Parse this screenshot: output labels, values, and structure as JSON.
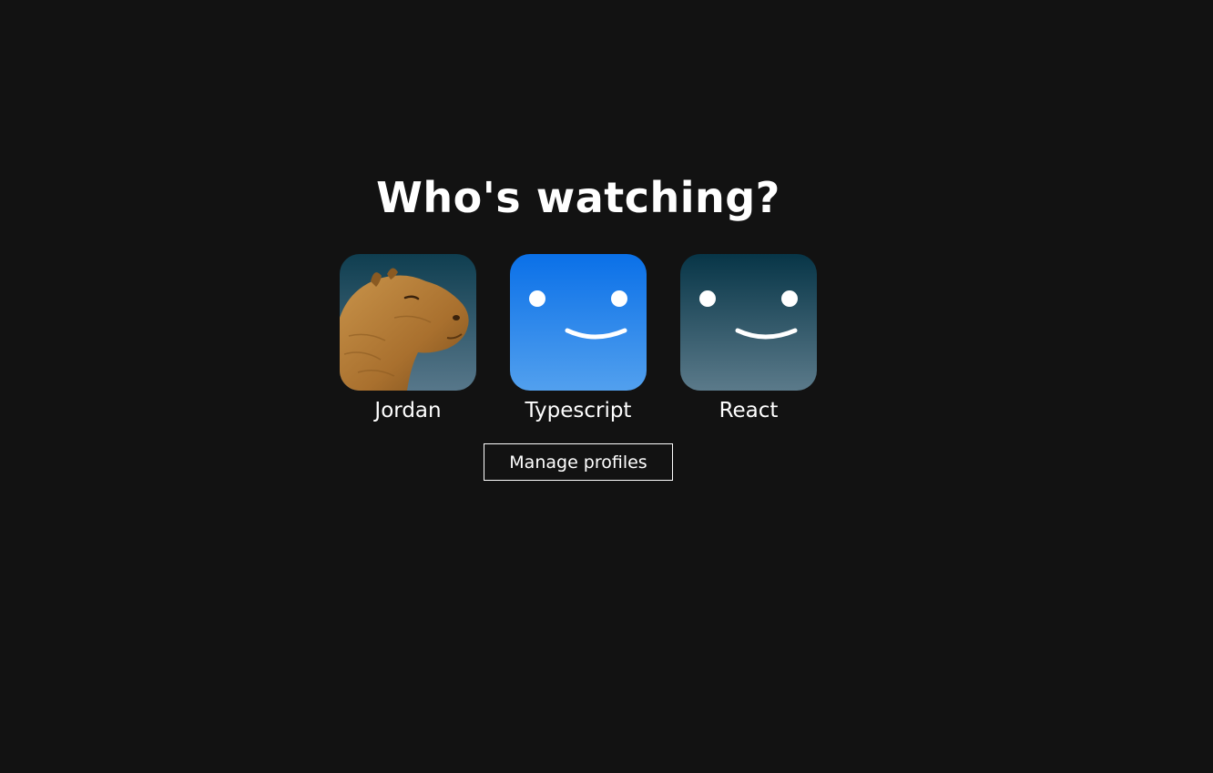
{
  "heading": "Who's watching?",
  "profiles": [
    {
      "name": "Jordan",
      "avatar": "capybara-photo",
      "colors": {
        "top": "#0f3e50",
        "bottom": "#57778a"
      }
    },
    {
      "name": "Typescript",
      "avatar": "smiley-face-icon",
      "colors": {
        "top": "#0a70e8",
        "bottom": "#52a0ee"
      }
    },
    {
      "name": "React",
      "avatar": "smiley-face-icon",
      "colors": {
        "top": "#073547",
        "bottom": "#5b7a8a"
      }
    }
  ],
  "manage_button": "Manage profiles",
  "theme": {
    "background": "#121212",
    "text": "#ffffff"
  }
}
